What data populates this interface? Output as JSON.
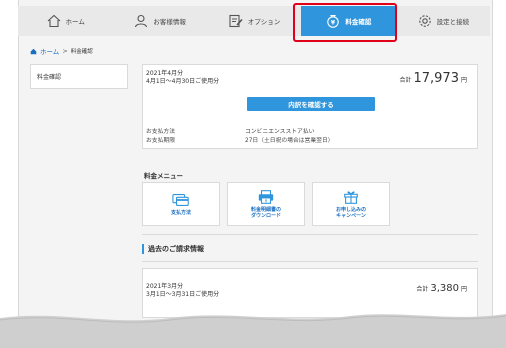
{
  "nav": {
    "items": [
      {
        "label": "ホーム",
        "icon": "home-icon"
      },
      {
        "label": "お客様情報",
        "icon": "user-icon"
      },
      {
        "label": "オプション",
        "icon": "option-edit-icon"
      },
      {
        "label": "料金確認",
        "icon": "money-bag-icon",
        "active": true
      },
      {
        "label": "設定と接続",
        "icon": "gear-icon"
      }
    ]
  },
  "breadcrumb": {
    "home": "ホーム",
    "sep": ">",
    "current": "料金確認"
  },
  "sidebar": {
    "items": [
      {
        "label": "料金確認"
      }
    ]
  },
  "current_bill": {
    "month": "2021年4月分",
    "range": "4月1日〜4月30日ご使用分",
    "total_label": "合計",
    "amount": "17,973",
    "currency": "円",
    "detail_button": "内訳を確認する",
    "payment_method_label": "お支払方法",
    "payment_method_value": "コンビニエンスストア払い",
    "payment_due_label": "お支払期限",
    "payment_due_value": "27日（土日祝の場合は営業翌日）"
  },
  "fee_menu": {
    "title": "料金メニュー",
    "tiles": [
      {
        "label": "支払方法",
        "icon": "card-icon"
      },
      {
        "label": "料金明細書の\nダウンロード",
        "icon": "printer-icon"
      },
      {
        "label": "お申し込みの\nキャンペーン",
        "icon": "gift-icon"
      }
    ]
  },
  "past": {
    "title": "過去のご請求情報",
    "month": "2021年3月分",
    "range": "3月1日〜3月31日ご使用分",
    "total_label": "合計",
    "amount": "3,380",
    "currency": "円"
  },
  "colors": {
    "accent": "#2f95dc",
    "highlight": "#e0001a",
    "link": "#1a6fc2"
  }
}
